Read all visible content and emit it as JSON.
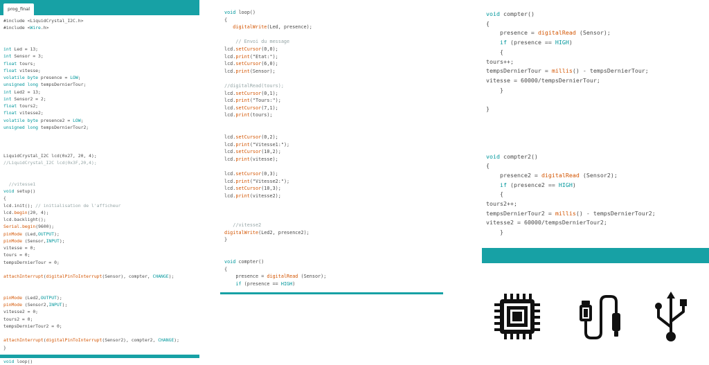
{
  "editor": {
    "tab_label": "prog_final"
  },
  "panel1_lines": [
    "#include <LiquidCrystal_I2C.h>",
    "#include <Wire.h>",
    "",
    "",
    "int Led = 13;",
    "int Sensor = 3;",
    "float tours;",
    "float vitesse;",
    "volatile byte presence = LOW;",
    "unsigned long tempsDernierTour;",
    "int Led2 = 13;",
    "int Sensor2 = 2;",
    "float tours2;",
    "float vitesse2;",
    "volatile byte presence2 = LOW;",
    "unsigned long tempsDernierTour2;",
    "",
    "",
    "",
    "LiquidCrystal_I2C lcd(0x27, 20, 4);",
    "//LiquidCrystal_I2C lcd(0x3F,20,4);",
    "",
    "",
    "  //vitesse1",
    "void setup()",
    "{",
    "lcd.init(); // initialisation de l'afficheur",
    "lcd.begin(20, 4);",
    "lcd.backlight();",
    "Serial.begin(9600);",
    "pinMode (Led,OUTPUT);",
    "pinMode (Sensor,INPUT);",
    "vitesse = 0;",
    "tours = 0;",
    "tempsDernierTour = 0;",
    "",
    "attachInterrupt(digitalPinToInterrupt(Sensor), compter, CHANGE);",
    "",
    "",
    "pinMode (Led2,OUTPUT);",
    "pinMode (Sensor2,INPUT);",
    "vitesse2 = 0;",
    "tours2 = 0;",
    "tempsDernierTour2 = 0;",
    "",
    "attachInterrupt(digitalPinToInterrupt(Sensor2), compter2, CHANGE);",
    "}",
    "",
    "void loop()"
  ],
  "panel2_lines": [
    "void loop()",
    "{",
    "   digitalWrite(Led, presence);",
    "",
    "    // Envoi du message",
    "lcd.setCursor(0,0);",
    "lcd.print(\"Etat:\");",
    "lcd.setCursor(6,0);",
    "lcd.print(Sensor);",
    "",
    "//digitalRead(tours);",
    "lcd.setCursor(0,1);",
    "lcd.print(\"Tours:\");",
    "lcd.setCursor(7,1);",
    "lcd.print(tours);",
    "",
    "",
    "lcd.setCursor(0,2);",
    "lcd.print(\"Vitesse1:\");",
    "lcd.setCursor(10,2);",
    "lcd.print(vitesse);",
    "",
    "lcd.setCursor(0,3);",
    "lcd.print(\"Vitesse2:\");",
    "lcd.setCursor(10,3);",
    "lcd.print(vitesse2);",
    "",
    "",
    "",
    "   //vitesse2",
    "digitalWrite(Led2, presence2);",
    "}",
    "",
    "",
    "void compter()",
    "{",
    "    presence = digitalRead (Sensor);",
    "    if (presence == HIGH)"
  ],
  "panel3_lines": [
    "void compter()",
    "{",
    "    presence = digitalRead (Sensor);",
    "    if (presence == HIGH)",
    "    {",
    "tours++;",
    "tempsDernierTour = millis() - tempsDernierTour;",
    "vitesse = 60000/tempsDernierTour;",
    "    }",
    "",
    "}",
    "",
    "",
    "",
    "",
    "void compter2()",
    "{",
    "    presence2 = digitalRead (Sensor2);",
    "    if (presence2 == HIGH)",
    "    {",
    "tours2++;",
    "tempsDernierTour2 = millis() - tempsDernierTour2;",
    "vitesse2 = 60000/tempsDernierTour2;",
    "    }",
    "",
    "}"
  ],
  "icons": [
    "microchip-icon",
    "usb-cable-icon",
    "usb-symbol-icon"
  ],
  "colors": {
    "accent": "#17a1a5",
    "keyword": "#00979c",
    "function": "#d35400",
    "comment": "#95a5a6",
    "text": "#4a4a4a"
  }
}
